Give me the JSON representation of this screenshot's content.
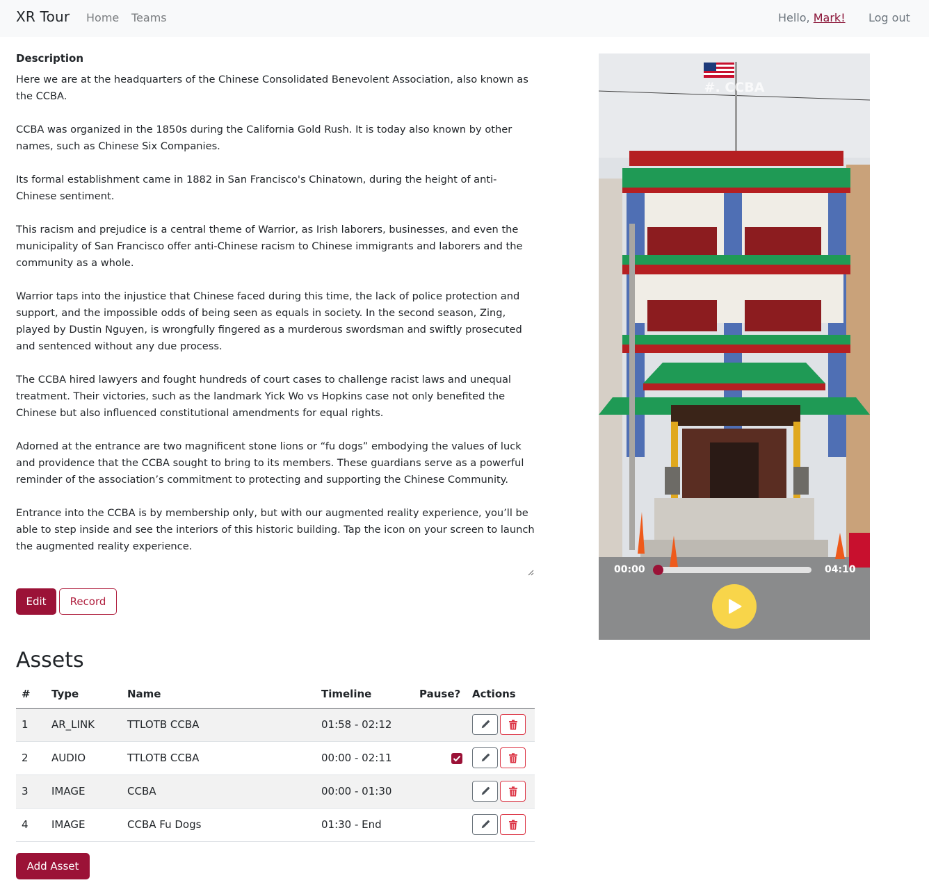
{
  "nav": {
    "brand": "XR Tour",
    "links": [
      {
        "label": "Home"
      },
      {
        "label": "Teams"
      }
    ],
    "greeting": "Hello, ",
    "user_name": "Mark!",
    "logout": "Log out"
  },
  "description": {
    "label": "Description",
    "paragraphs": [
      "Here we are at the headquarters of the Chinese Consolidated Benevolent Association, also known as the CCBA.",
      "CCBA was organized in the 1850s during the California Gold Rush. It is today also known by other names, such as Chinese Six Companies.",
      "Its formal establishment came in 1882 in San Francisco's Chinatown, during the height of anti-Chinese sentiment.",
      "This racism and prejudice is a central theme of Warrior, as Irish laborers, businesses, and even the municipality of San Francisco offer anti-Chinese racism to Chinese immigrants and laborers and the community as a whole.",
      "Warrior taps into the injustice that Chinese faced during this time, the lack of police protection and support, and the impossible odds of being seen as equals in society. In the second season, Zing, played by Dustin Nguyen, is wrongfully fingered as a murderous swordsman and swiftly prosecuted and sentenced without any due process.",
      "The CCBA hired lawyers and fought hundreds of court cases to challenge racist laws and unequal treatment. Their victories, such as the landmark Yick Wo vs Hopkins case not only benefited the Chinese but also influenced constitutional amendments for equal rights.",
      "Adorned at the entrance are two magnificent stone lions or “fu dogs” embodying the values of luck and providence that the CCBA sought to bring to its members. These guardians serve as a powerful reminder of the association’s commitment to protecting and supporting the Chinese Community.",
      "Entrance into the CCBA is by membership only, but with our augmented reality experience, you’ll be able to step inside and see the interiors of this historic building. Tap the icon on your screen to launch the augmented reality experience."
    ]
  },
  "buttons": {
    "edit": "Edit",
    "record": "Record",
    "add_asset": "Add Asset"
  },
  "assets": {
    "title": "Assets",
    "columns": [
      "#",
      "Type",
      "Name",
      "Timeline",
      "Pause?",
      "Actions"
    ],
    "rows": [
      {
        "num": "1",
        "type": "AR_LINK",
        "name": "TTLOTB CCBA",
        "timeline": "01:58 - 02:12",
        "pause": false
      },
      {
        "num": "2",
        "type": "AUDIO",
        "name": "TTLOTB CCBA",
        "timeline": "00:00 - 02:11",
        "pause": true
      },
      {
        "num": "3",
        "type": "IMAGE",
        "name": "CCBA",
        "timeline": "00:00 - 01:30",
        "pause": false
      },
      {
        "num": "4",
        "type": "IMAGE",
        "name": "CCBA Fu Dogs",
        "timeline": "01:30 - End",
        "pause": false
      }
    ]
  },
  "media": {
    "title": "#. CCBA",
    "current_time": "00:00",
    "total_time": "04:10",
    "progress": 0.0,
    "play_icon": "play-icon"
  },
  "colors": {
    "accent": "#9b1237",
    "navbar_bg": "#f8f9fa",
    "play_button": "#f8d54a",
    "delete": "#dc3545"
  }
}
